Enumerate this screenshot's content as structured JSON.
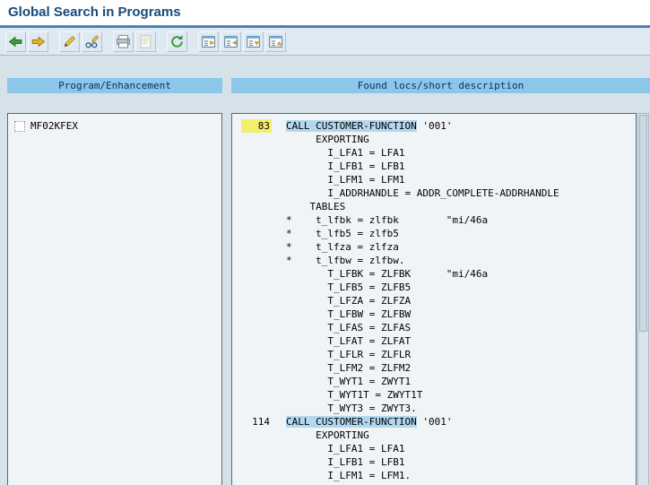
{
  "title": "Global Search in Programs",
  "columns": {
    "program": "Program/Enhancement",
    "findings": "Found locs/short description"
  },
  "toolbar": {
    "groups": [
      [
        "back",
        "forward"
      ],
      [
        "edit",
        "display-change"
      ],
      [
        "print",
        "print-preview"
      ],
      [
        "refresh"
      ],
      [
        "expand-node",
        "collapse-node",
        "expand-all",
        "collapse-all"
      ]
    ]
  },
  "programs": [
    {
      "name": "MF02KFEX"
    }
  ],
  "code": {
    "lines": [
      {
        "num": "83",
        "num_highlight": true,
        "pre": "",
        "match": "CALL CUSTOMER-FUNCTION",
        "post": " '001'"
      },
      {
        "text": "     EXPORTING"
      },
      {
        "text": "       I_LFA1 = LFA1"
      },
      {
        "text": "       I_LFB1 = LFB1"
      },
      {
        "text": "       I_LFM1 = LFM1"
      },
      {
        "text": "       I_ADDRHANDLE = ADDR_COMPLETE-ADDRHANDLE"
      },
      {
        "text": "    TABLES"
      },
      {
        "text": "*    t_lfbk = zlfbk        \"mi/46a"
      },
      {
        "text": "*    t_lfb5 = zlfb5"
      },
      {
        "text": "*    t_lfza = zlfza"
      },
      {
        "text": "*    t_lfbw = zlfbw."
      },
      {
        "text": "       T_LFBK = ZLFBK      \"mi/46a"
      },
      {
        "text": "       T_LFB5 = ZLFB5"
      },
      {
        "text": "       T_LFZA = ZLFZA"
      },
      {
        "text": "       T_LFBW = ZLFBW"
      },
      {
        "text": "       T_LFAS = ZLFAS"
      },
      {
        "text": "       T_LFAT = ZLFAT"
      },
      {
        "text": "       T_LFLR = ZLFLR"
      },
      {
        "text": "       T_LFM2 = ZLFM2"
      },
      {
        "text": "       T_WYT1 = ZWYT1"
      },
      {
        "text": "       T_WYT1T = ZWYT1T"
      },
      {
        "text": "       T_WYT3 = ZWYT3."
      },
      {
        "num": "114",
        "num_highlight": false,
        "pre": "",
        "match": "CALL CUSTOMER-FUNCTION",
        "post": " '001'"
      },
      {
        "text": "     EXPORTING"
      },
      {
        "text": "       I_LFA1 = LFA1"
      },
      {
        "text": "       I_LFB1 = LFB1"
      },
      {
        "text": "       I_LFM1 = LFM1."
      }
    ]
  },
  "colors": {
    "title_blue": "#174a7c",
    "header_blue": "#8cc6e8",
    "header_text": "#0a2f5c",
    "hit_yellow": "#f3ef6d",
    "match_blue": "#b2d7ef"
  }
}
